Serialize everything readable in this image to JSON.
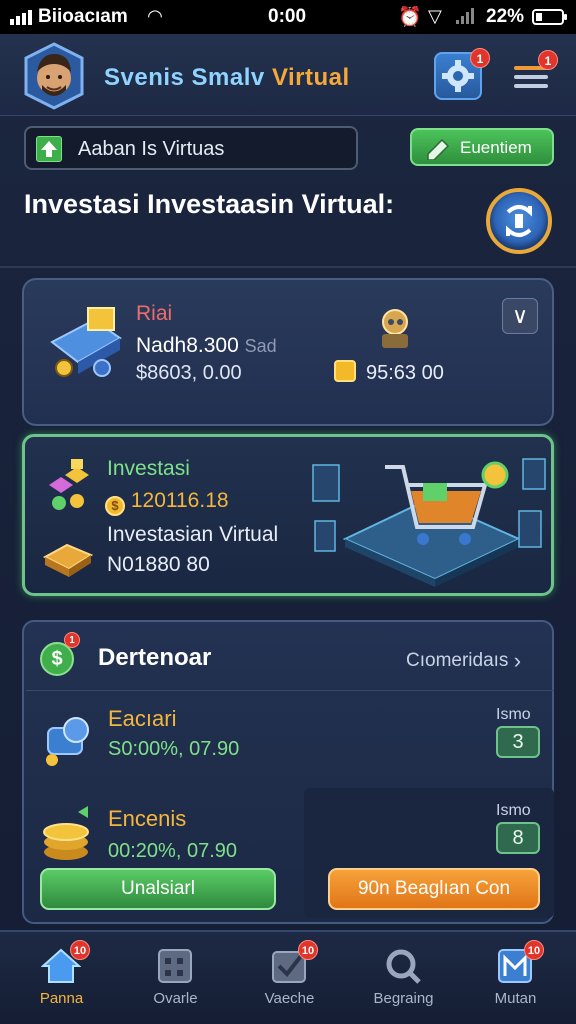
{
  "status_bar": {
    "carrier": "Biioacıam",
    "time": "0:00",
    "battery": "22%"
  },
  "header": {
    "title_part1": "Svenis Smalv",
    "title_part2": "Virtual",
    "settings_badge": "1",
    "menu_badge": "1"
  },
  "search": {
    "value": "Aaban Is Virtuas"
  },
  "top_button": {
    "label": "Euentiem"
  },
  "section": {
    "heading": "Investasi Investaasin Virtual:"
  },
  "card1": {
    "title": "Riai",
    "line2_main": "Nadh8.300",
    "line2_muted": "Sad",
    "line3": "$8603, 0.00",
    "coin_value": "95:63 00"
  },
  "card2": {
    "title": "Investasi",
    "amount": "120116.18",
    "subtitle": "Investasian Virtual",
    "code": "N01880 80"
  },
  "card3": {
    "title": "Dertenoar",
    "link": "Cıomeridaıs",
    "dollar_badge": "1",
    "rows": [
      {
        "title": "Eacıari",
        "value": "S0:00%, 07.90",
        "right_label": "Ismo",
        "count": "3"
      },
      {
        "title": "Encenis",
        "value": "00:20%, 07.90",
        "right_label": "Ismo",
        "count": "8"
      }
    ],
    "btn_green": "Unalsiarl",
    "btn_orange": "90n   Beaglıan Con"
  },
  "nav": {
    "items": [
      {
        "label": "Panna",
        "icon": "home-icon",
        "badge": "10"
      },
      {
        "label": "Ovarle",
        "icon": "grid-icon",
        "badge": ""
      },
      {
        "label": "Vaeche",
        "icon": "checkbox-icon",
        "badge": "10"
      },
      {
        "label": "Begraing",
        "icon": "search-icon",
        "badge": ""
      },
      {
        "label": "Mutan",
        "icon": "chart-icon",
        "badge": "10"
      }
    ]
  },
  "colors": {
    "accent_blue": "#8fd3ff",
    "accent_orange": "#f4a93a",
    "green": "#4cc35a",
    "badge_red": "#e0352b"
  }
}
